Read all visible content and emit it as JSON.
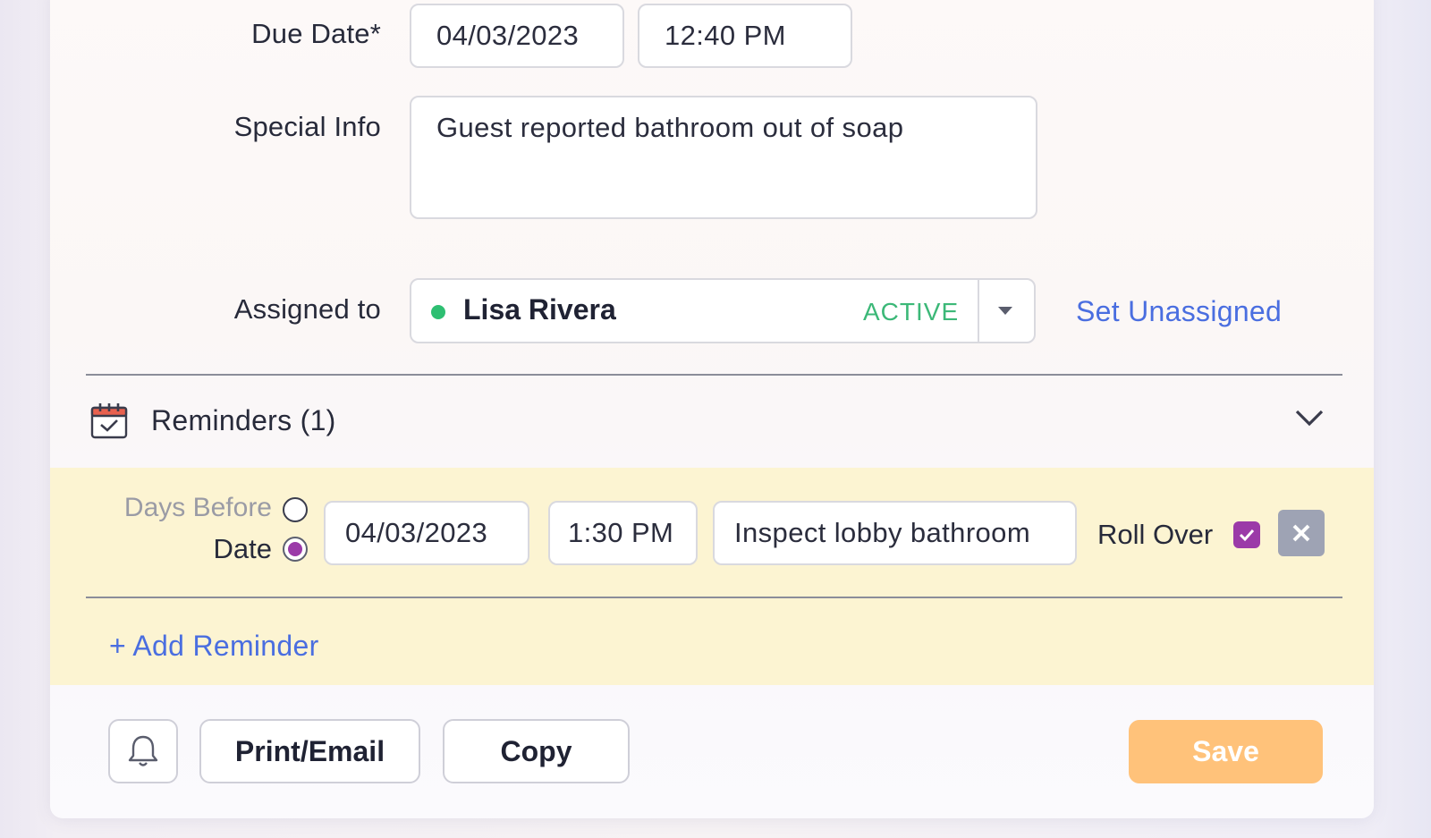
{
  "form": {
    "due_date": {
      "label": "Due Date*",
      "date": "04/03/2023",
      "time": "12:40 PM"
    },
    "special_info": {
      "label": "Special Info",
      "value": "Guest reported bathroom out of soap"
    },
    "assigned_to": {
      "label": "Assigned to",
      "name": "Lisa Rivera",
      "status": "ACTIVE",
      "status_color": "#3cb878",
      "set_unassigned": "Set Unassigned"
    }
  },
  "reminders": {
    "title": "Reminders (1)",
    "icon": "calendar-check-icon",
    "items": [
      {
        "mode_options": {
          "days_before": "Days Before",
          "date": "Date"
        },
        "selected_mode": "Date",
        "date": "04/03/2023",
        "time": "1:30 PM",
        "note": "Inspect lobby bathroom",
        "roll_over_label": "Roll Over",
        "roll_over": true
      }
    ],
    "add_label": "+ Add Reminder"
  },
  "footer": {
    "bell_icon": "bell-icon",
    "print_email": "Print/Email",
    "copy": "Copy",
    "save": "Save"
  },
  "colors": {
    "accent_link": "#4a6ee0",
    "save_button": "#ffc27a",
    "checkbox": "#9b3aa8",
    "reminder_band": "#fcf4d2"
  }
}
